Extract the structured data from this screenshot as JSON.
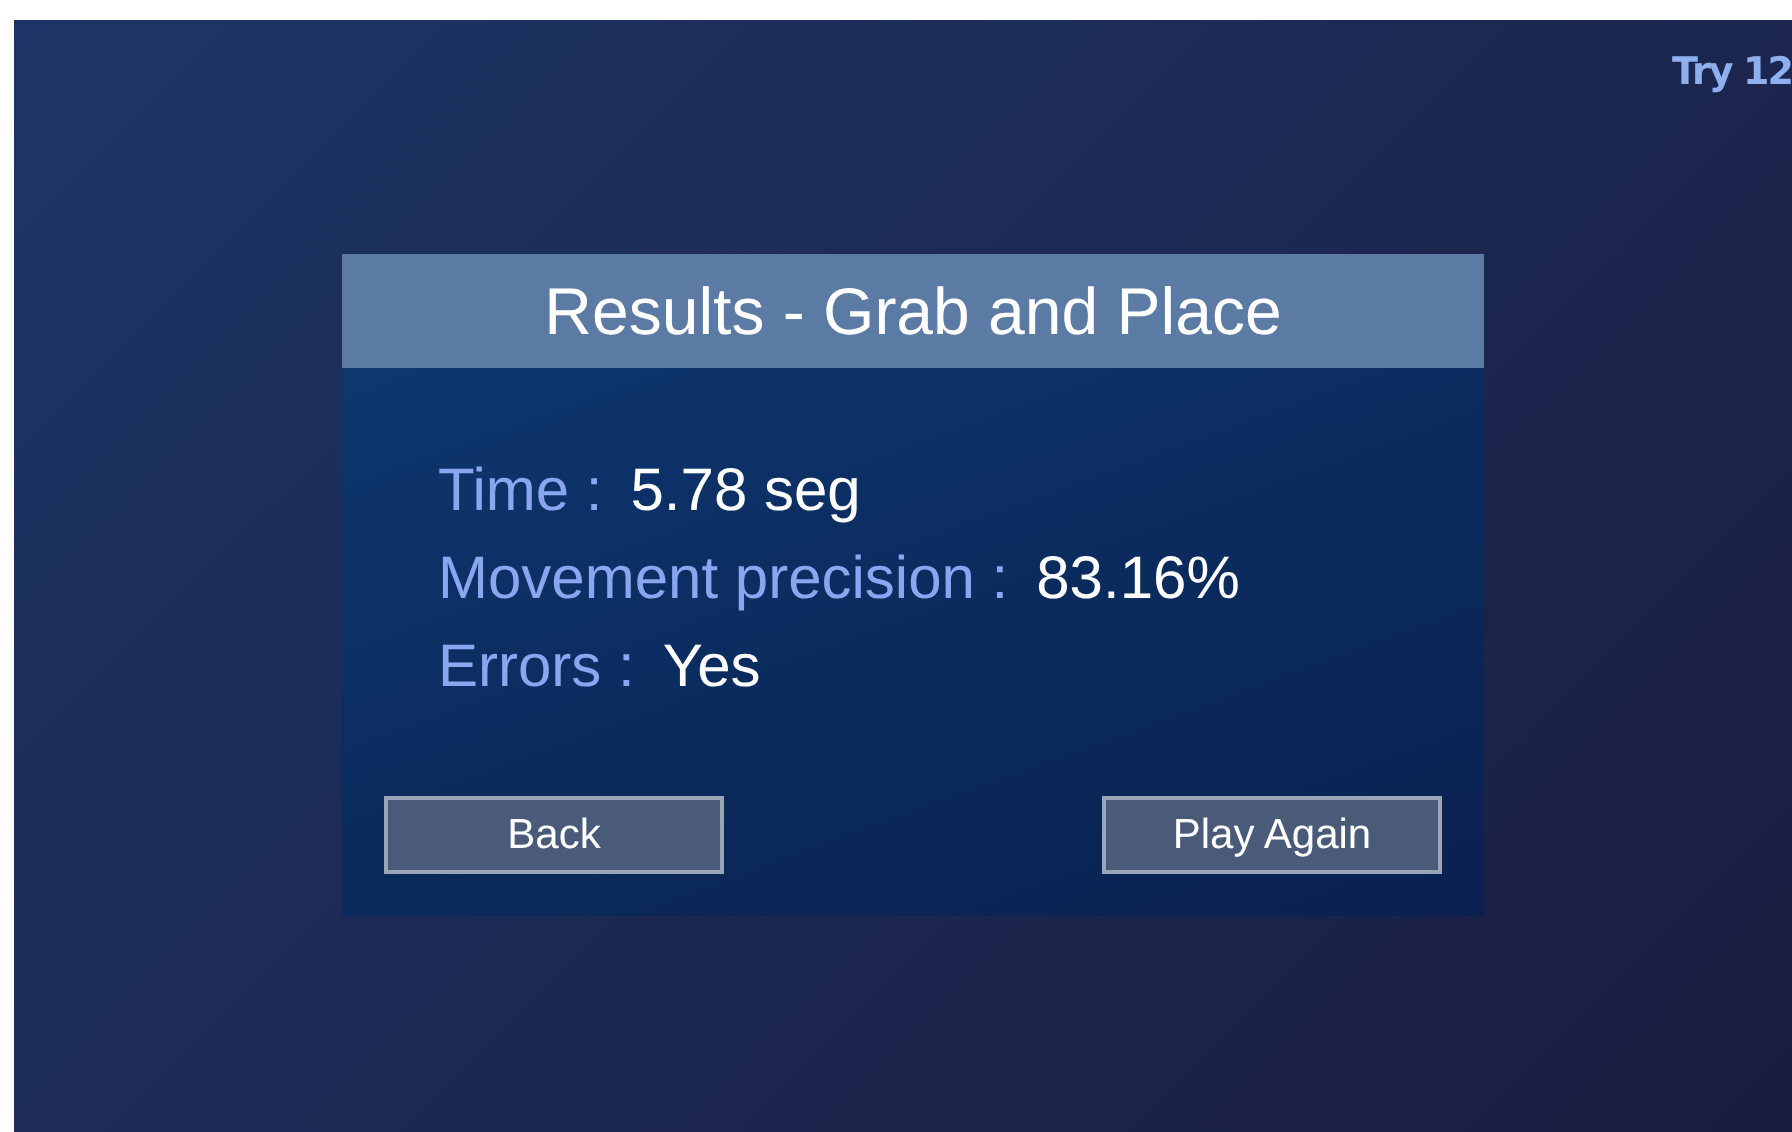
{
  "try_counter": "Try 12",
  "dialog": {
    "title": "Results - Grab and Place",
    "stats": [
      {
        "label": "Time :",
        "value": "5.78 seg"
      },
      {
        "label": "Movement precision :",
        "value": "83.16%"
      },
      {
        "label": "Errors :",
        "value": "Yes"
      }
    ],
    "buttons": [
      "Back",
      "Play Again"
    ]
  }
}
